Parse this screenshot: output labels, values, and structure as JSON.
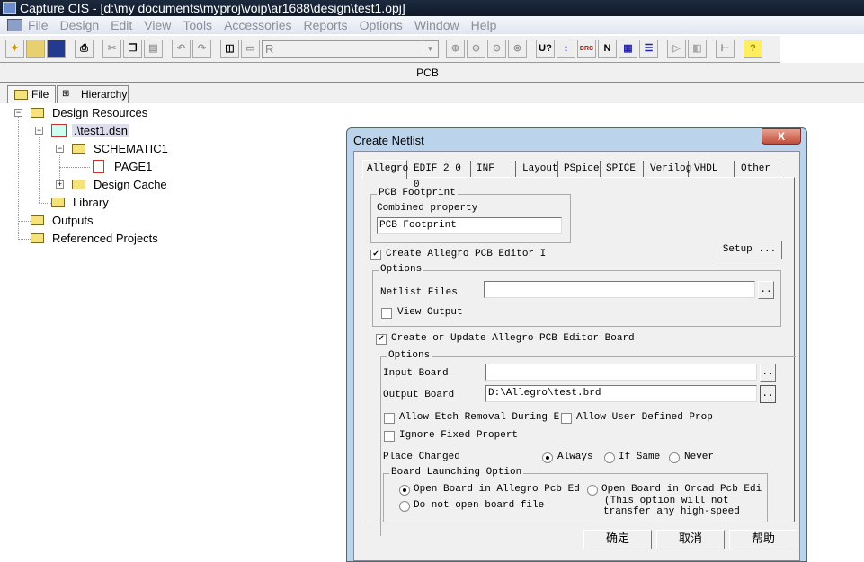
{
  "app": {
    "title": "Capture CIS - [d:\\my documents\\myproj\\voip\\ar1688\\design\\test1.opj]"
  },
  "menu": [
    "File",
    "Design",
    "Edit",
    "View",
    "Tools",
    "Accessories",
    "Reports",
    "Options",
    "Window",
    "Help"
  ],
  "toolbar": {
    "part_combo": "R",
    "group1": [
      "new-icon",
      "open-icon",
      "save-icon"
    ],
    "group2": [
      "print-icon"
    ],
    "group3": [
      "cut-icon",
      "copy-icon",
      "paste-icon"
    ],
    "group4": [
      "undo-icon",
      "redo-icon"
    ],
    "group5": [
      "tile-icon",
      "cascade-icon"
    ],
    "group6": [
      "zoom-in-icon",
      "zoom-out-icon",
      "zoom-area-icon",
      "zoom-all-icon"
    ],
    "group7": [
      "annotate-icon",
      "back-annotate-icon",
      "drc-icon",
      "netlist-icon",
      "cross-ref-icon",
      "bom-icon"
    ],
    "group8": [
      "snap-icon",
      "project-icon",
      "hierarchy-icon",
      "help-icon"
    ],
    "annotate_label": "U?",
    "drc_label": "DRC",
    "help_label": "?"
  },
  "pcb_label": "PCB",
  "panel_tabs": [
    "File",
    "Hierarchy"
  ],
  "tree": [
    {
      "label": "Design Resources",
      "level": 0
    },
    {
      "label": ".\\test1.dsn",
      "level": 1
    },
    {
      "label": "SCHEMATIC1",
      "level": 2
    },
    {
      "label": "PAGE1",
      "level": 3
    },
    {
      "label": "Design Cache",
      "level": 2
    },
    {
      "label": "Library",
      "level": 1
    },
    {
      "label": "Outputs",
      "level": 0
    },
    {
      "label": "Referenced Projects",
      "level": 0
    }
  ],
  "dialog": {
    "title": "Create Netlist",
    "close": "X",
    "tabs": [
      "Allegro",
      "EDIF 2 0 0",
      "INF",
      "Layout",
      "PSpice",
      "SPICE",
      "Verilog",
      "VHDL",
      "Other"
    ],
    "pcb_footprint_group": "PCB Footprint",
    "combined_property_label": "Combined property",
    "combined_property_value": "PCB Footprint",
    "create_allegro_label": "Create Allegro PCB Editor I",
    "create_allegro_checked": true,
    "setup_button": "Setup ...",
    "options1_group": "Options",
    "netlist_files_label": "Netlist Files",
    "netlist_files_value": "",
    "browse": "..",
    "view_output_label": "View Output",
    "view_output_checked": false,
    "create_update_label": "Create or Update Allegro PCB Editor Board",
    "create_update_checked": true,
    "options2_group": "Options",
    "input_board_label": "Input Board",
    "input_board_value": "",
    "output_board_label": "Output Board",
    "output_board_value": "D:\\Allegro\\test.brd",
    "allow_etch_label": "Allow Etch Removal During E",
    "allow_user_prop_label": "Allow User Defined Prop",
    "ignore_fixed_label": "Ignore Fixed Propert",
    "place_changed_label": "Place Changed",
    "place_options": [
      "Always",
      "If Same",
      "Never"
    ],
    "place_selected": "Always",
    "board_launch_group": "Board Launching Option",
    "launch_allegro": "Open Board in Allegro Pcb Ed",
    "launch_orcad": "Open Board in Orcad Pcb Edi",
    "launch_orcad_note1": "(This option will not",
    "launch_orcad_note2": "transfer any high-speed",
    "launch_none": "Do not open board file",
    "ok": "确定",
    "cancel": "取消",
    "help": "帮助"
  }
}
